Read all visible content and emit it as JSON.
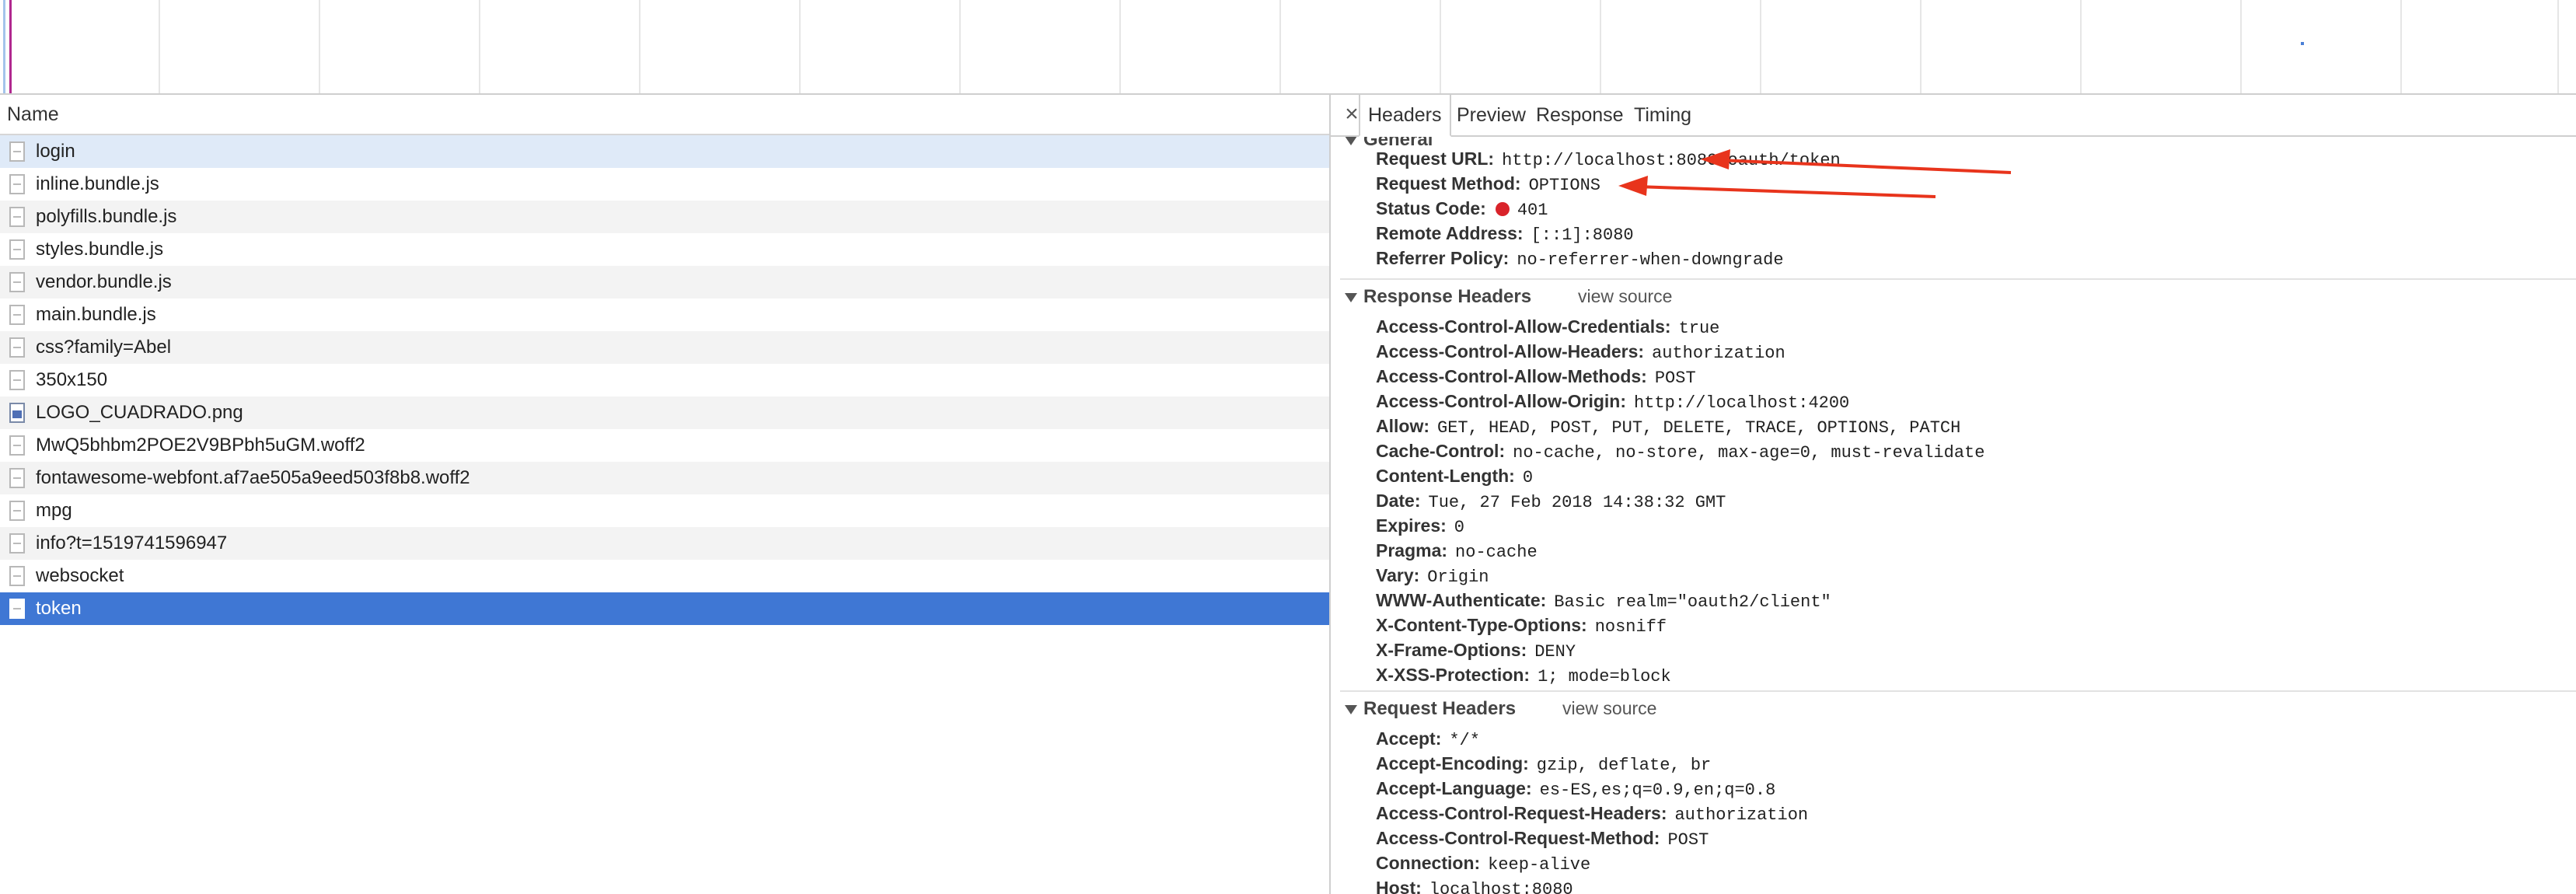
{
  "request_list": {
    "column_header": "Name",
    "items": [
      {
        "name": "login",
        "icon": "document-icon"
      },
      {
        "name": "inline.bundle.js",
        "icon": "document-icon"
      },
      {
        "name": "polyfills.bundle.js",
        "icon": "document-icon"
      },
      {
        "name": "styles.bundle.js",
        "icon": "document-icon"
      },
      {
        "name": "vendor.bundle.js",
        "icon": "document-icon"
      },
      {
        "name": "main.bundle.js",
        "icon": "document-icon"
      },
      {
        "name": "css?family=Abel",
        "icon": "document-icon"
      },
      {
        "name": "350x150",
        "icon": "document-icon"
      },
      {
        "name": "LOGO_CUADRADO.png",
        "icon": "image-icon"
      },
      {
        "name": "MwQ5bhbm2POE2V9BPbh5uGM.woff2",
        "icon": "document-icon"
      },
      {
        "name": "fontawesome-webfont.af7ae505a9eed503f8b8.woff2",
        "icon": "document-icon"
      },
      {
        "name": "mpg",
        "icon": "document-icon"
      },
      {
        "name": "info?t=1519741596947",
        "icon": "document-icon"
      },
      {
        "name": "websocket",
        "icon": "document-icon"
      },
      {
        "name": "token",
        "icon": "document-icon"
      }
    ],
    "selected_index": 14
  },
  "details": {
    "close_label": "×",
    "tabs": [
      "Headers",
      "Preview",
      "Response",
      "Timing"
    ],
    "active_tab": "Headers",
    "general": {
      "title": "General",
      "request_url_key": "Request URL:",
      "request_url": "http://localhost:8080/oauth/token",
      "request_method_key": "Request Method:",
      "request_method": "OPTIONS",
      "status_code_key": "Status Code:",
      "status_code": "401",
      "remote_address_key": "Remote Address:",
      "remote_address": "[::1]:8080",
      "referrer_policy_key": "Referrer Policy:",
      "referrer_policy": "no-referrer-when-downgrade"
    },
    "response_headers": {
      "title": "Response Headers",
      "view_source": "view source",
      "items": [
        {
          "k": "Access-Control-Allow-Credentials:",
          "v": "true"
        },
        {
          "k": "Access-Control-Allow-Headers:",
          "v": "authorization"
        },
        {
          "k": "Access-Control-Allow-Methods:",
          "v": "POST"
        },
        {
          "k": "Access-Control-Allow-Origin:",
          "v": "http://localhost:4200"
        },
        {
          "k": "Allow:",
          "v": "GET, HEAD, POST, PUT, DELETE, TRACE, OPTIONS, PATCH"
        },
        {
          "k": "Cache-Control:",
          "v": "no-cache, no-store, max-age=0, must-revalidate"
        },
        {
          "k": "Content-Length:",
          "v": "0"
        },
        {
          "k": "Date:",
          "v": "Tue, 27 Feb 2018 14:38:32 GMT"
        },
        {
          "k": "Expires:",
          "v": "0"
        },
        {
          "k": "Pragma:",
          "v": "no-cache"
        },
        {
          "k": "Vary:",
          "v": "Origin"
        },
        {
          "k": "WWW-Authenticate:",
          "v": "Basic realm=\"oauth2/client\""
        },
        {
          "k": "X-Content-Type-Options:",
          "v": "nosniff"
        },
        {
          "k": "X-Frame-Options:",
          "v": "DENY"
        },
        {
          "k": "X-XSS-Protection:",
          "v": "1; mode=block"
        }
      ]
    },
    "request_headers": {
      "title": "Request Headers",
      "view_source": "view source",
      "items": [
        {
          "k": "Accept:",
          "v": "*/*"
        },
        {
          "k": "Accept-Encoding:",
          "v": "gzip, deflate, br"
        },
        {
          "k": "Accept-Language:",
          "v": "es-ES,es;q=0.9,en;q=0.8"
        },
        {
          "k": "Access-Control-Request-Headers:",
          "v": "authorization"
        },
        {
          "k": "Access-Control-Request-Method:",
          "v": "POST"
        },
        {
          "k": "Connection:",
          "v": "keep-alive"
        },
        {
          "k": "Host:",
          "v": "localhost:8080"
        }
      ]
    }
  },
  "colors": {
    "selected_row": "#3f77d4",
    "first_row": "#dfeaf8",
    "status_error": "#d9232a",
    "annotation_arrow": "#e8341c"
  }
}
